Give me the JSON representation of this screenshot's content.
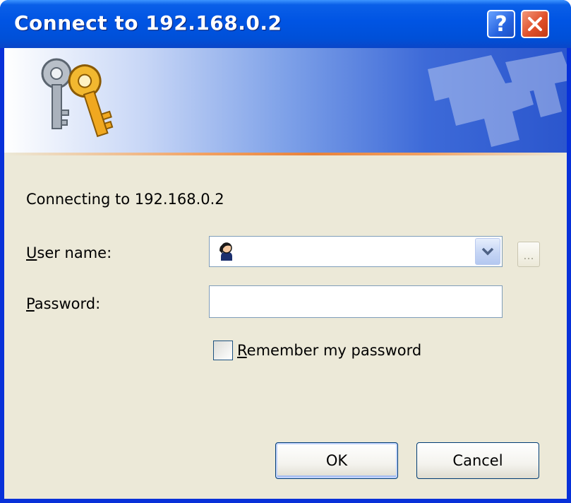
{
  "window": {
    "title": "Connect to 192.168.0.2"
  },
  "titlebar_buttons": {
    "help_label": "?",
    "close_icon": "close-x-icon"
  },
  "banner": {
    "icon": "keys-icon"
  },
  "message": {
    "connecting_text": "Connecting to 192.168.0.2"
  },
  "form": {
    "username": {
      "label_mnemonic": "U",
      "label_rest": "ser name:",
      "value": "",
      "icon": "user-icon"
    },
    "password": {
      "label_mnemonic": "P",
      "label_rest": "assword:",
      "value": ""
    },
    "remember": {
      "label_mnemonic": "R",
      "label_rest": "emember my password",
      "checked": false
    },
    "browse_label": "..."
  },
  "buttons": {
    "ok_label": "OK",
    "cancel_label": "Cancel"
  },
  "colors": {
    "titlebar": "#0054e3",
    "client_bg": "#ece9d8",
    "accent_line": "#e8823a"
  }
}
